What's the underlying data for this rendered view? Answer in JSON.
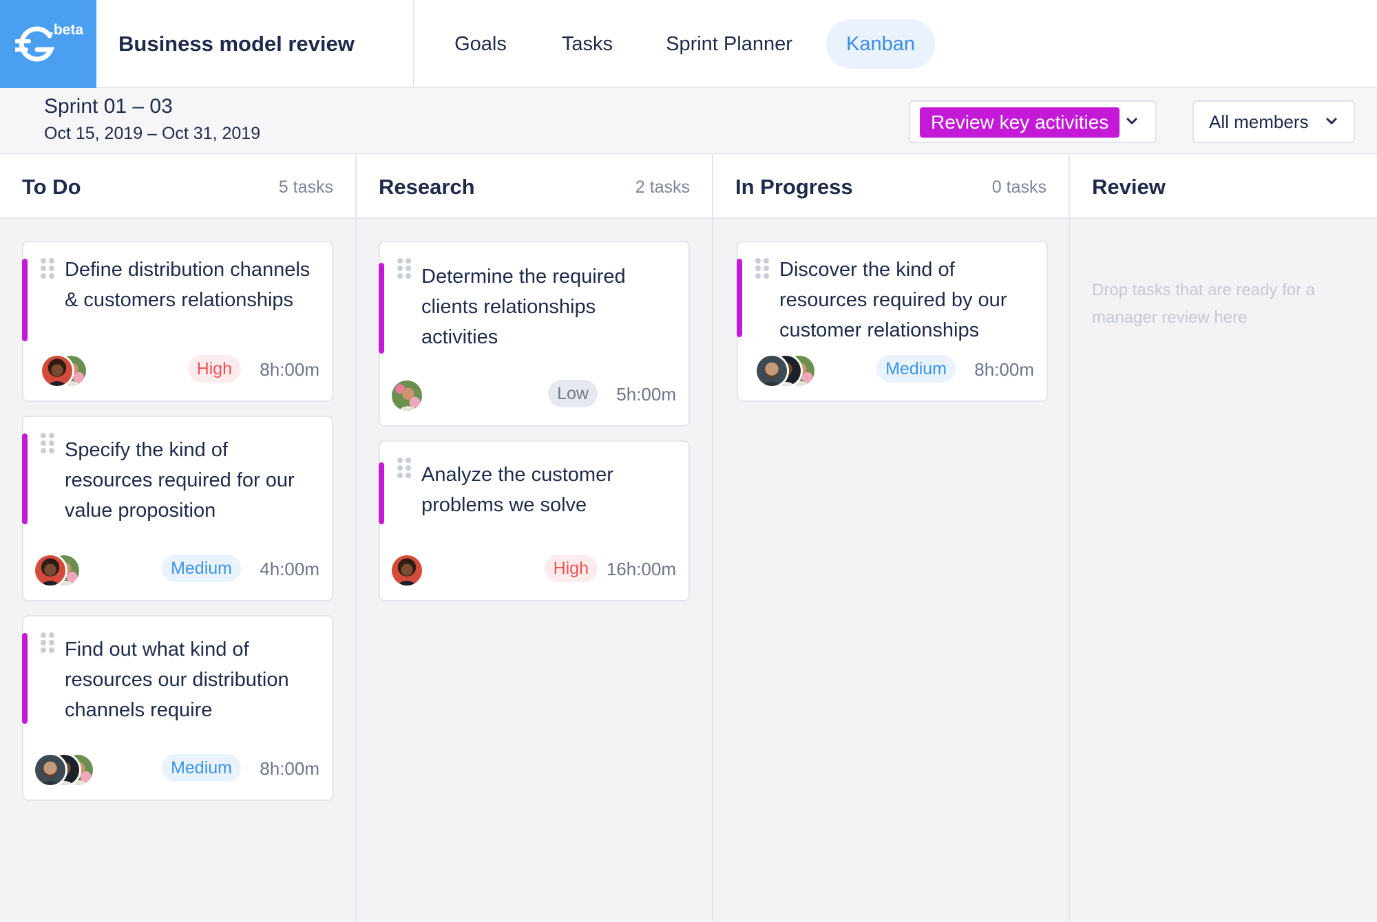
{
  "app": {
    "beta_label": ".beta",
    "project_title": "Business model review"
  },
  "nav": {
    "tabs": [
      {
        "label": "Goals",
        "active": false
      },
      {
        "label": "Tasks",
        "active": false
      },
      {
        "label": "Sprint Planner",
        "active": false
      },
      {
        "label": "Kanban",
        "active": true
      }
    ]
  },
  "sprint": {
    "name": "Sprint 01 – 03",
    "dates": "Oct 15, 2019 – Oct 31, 2019",
    "goal_filter": "Review key activities",
    "members_filter": "All members"
  },
  "colors": {
    "brand": "#4a9ff0",
    "accent": "#c41ad8",
    "high": "#ef5350",
    "medium": "#3a95e8",
    "low": "#70798c"
  },
  "columns": [
    {
      "title": "To Do",
      "count": "5 tasks",
      "cards": [
        {
          "title": "Define distribution channels & customers relationships",
          "priority": "High",
          "duration": "8h:00m",
          "avatars": [
            "avatar-woman-dark",
            "avatar-woman-flowers"
          ]
        },
        {
          "title": "Specify the kind of resources required for our value proposition",
          "priority": "Medium",
          "duration": "4h:00m",
          "avatars": [
            "avatar-woman-dark",
            "avatar-woman-flowers"
          ]
        },
        {
          "title": "Find out what kind of resources our distribution channels require",
          "priority": "Medium",
          "duration": "8h:00m",
          "avatars": [
            "avatar-man-beard",
            "avatar-man-dark",
            "avatar-woman-flowers"
          ]
        }
      ]
    },
    {
      "title": "Research",
      "count": "2 tasks",
      "cards": [
        {
          "title": "Determine the required clients relationships activities",
          "priority": "Low",
          "duration": "5h:00m",
          "avatars": [
            "avatar-woman-flowers"
          ]
        },
        {
          "title": "Analyze the customer problems we solve",
          "priority": "High",
          "duration": "16h:00m",
          "avatars": [
            "avatar-woman-dark"
          ]
        }
      ]
    },
    {
      "title": "In Progress",
      "count": "0 tasks",
      "cards": [
        {
          "title": "Discover the kind of resources required by our customer relationships",
          "priority": "Medium",
          "duration": "8h:00m",
          "avatars": [
            "avatar-man-beard",
            "avatar-man-dark",
            "avatar-woman-flowers"
          ]
        }
      ]
    },
    {
      "title": "Review",
      "count": "",
      "empty_hint": "Drop tasks that are ready for a manager review here",
      "cards": []
    }
  ]
}
